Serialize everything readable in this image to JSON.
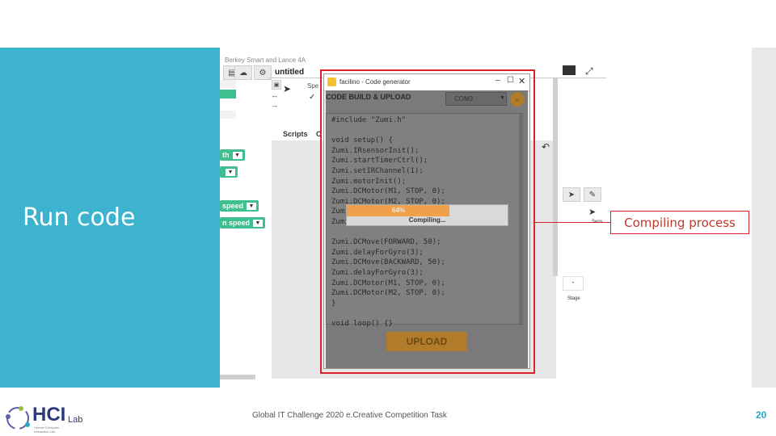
{
  "slide": {
    "title": "Run code",
    "callout": "Compiling process",
    "footer": "Global IT Challenge 2020 e.Creative Competition Task",
    "page_number": "20",
    "logo": {
      "main": "HCI",
      "sub": "Lab",
      "tag1": "Human Computer",
      "tag2": "Interaction Lab"
    }
  },
  "app": {
    "breadcrumb": "Berkey Smart and Lance 4A",
    "project_title": "untitled",
    "tab_scripts": "Scripts",
    "tab_c": "C",
    "blocks": [
      "th",
      "speed",
      "n speed"
    ],
    "right_panel_label": "Sens",
    "stage_label": "Stage",
    "stage_mark": "-"
  },
  "dialog": {
    "title": "facilino - Code generator",
    "header": "CODE BUILD & UPLOAD",
    "port": "COM3",
    "code_lines": [
      "#include \"Zumi.h\"",
      "",
      "void setup() {",
      "  Zumi.IRsensorInit();",
      "  Zumi.startTimerCtrl();",
      "  Zumi.setIRChannel(1);",
      "  Zumi.motorInit();",
      "  Zumi.DCMotor(M1, STOP, 0);",
      "  Zumi.DCMotor(M2, STOP, 0);",
      "  Zumi.DCMotor(FORWARD, 50);",
      "  Zumi.delayForGyro(3);",
      "",
      "  Zumi.DCMove(FORWARD, 50);",
      "  Zumi.delayForGyro(3);",
      "  Zumi.DCMove(BACKWARD, 50);",
      "  Zumi.delayForGyro(3);",
      "  Zumi.DCMotor(M1, STOP, 0);",
      "  Zumi.DCMotor(M2, STOP, 0);",
      "}",
      "",
      "void loop() {}"
    ],
    "progress_percent": 64,
    "progress_label": "64%",
    "progress_status": "Compiling...",
    "upload_label": "UPLOAD"
  }
}
